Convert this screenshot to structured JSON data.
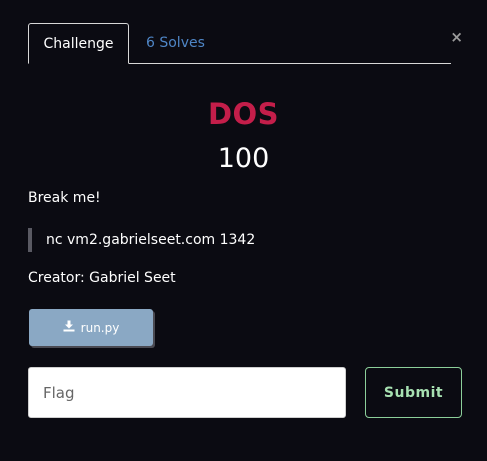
{
  "tabs": {
    "challenge_label": "Challenge",
    "solves_label": "6 Solves"
  },
  "close_glyph": "×",
  "challenge": {
    "name": "DOS",
    "points": "100",
    "description": "Break me!",
    "connection": "nc vm2.gabrielseet.com 1342",
    "creator": "Creator: Gabriel Seet"
  },
  "file": {
    "label": "run.py",
    "icon": "download-icon"
  },
  "flag_input": {
    "placeholder": "Flag",
    "value": ""
  },
  "submit_label": "Submit",
  "colors": {
    "background": "#0b0b12",
    "title": "#c41e4a",
    "solves_link": "#4f86c6",
    "file_button": "#8aa8c4",
    "submit_border": "#8ccf9a"
  }
}
